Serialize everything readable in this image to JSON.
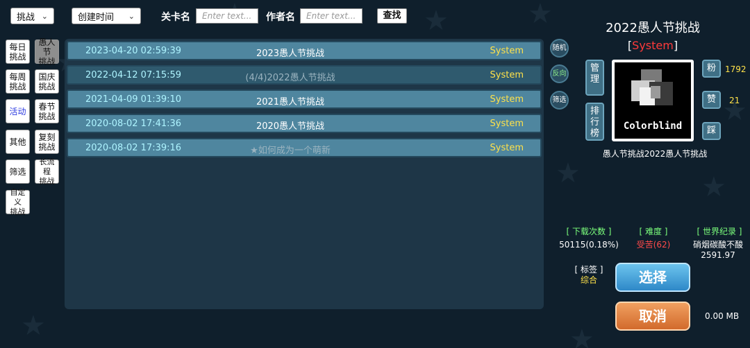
{
  "topbar": {
    "mode_value": "挑战",
    "sort_value": "创建时间",
    "level_name_label": "关卡名",
    "level_name_placeholder": "Enter text...",
    "author_label": "作者名",
    "author_placeholder": "Enter text...",
    "search_label": "查找"
  },
  "categories": [
    {
      "label": "每日\n挑战"
    },
    {
      "label": "愚人节\n挑战"
    },
    {
      "label": "每周\n挑战"
    },
    {
      "label": "国庆\n挑战"
    },
    {
      "label": "活动"
    },
    {
      "label": "春节\n挑战"
    },
    {
      "label": "其他"
    },
    {
      "label": "复刻\n挑战"
    },
    {
      "label": "筛选"
    },
    {
      "label": "长流程\n挑战"
    },
    {
      "label": "自定义\n挑战"
    }
  ],
  "levels": [
    {
      "date": "2023-04-20 02:59:39",
      "title": "2023愚人节挑战",
      "author": "System"
    },
    {
      "date": "2022-04-12 07:15:59",
      "title": "(4/4)2022愚人节挑战",
      "author": "System"
    },
    {
      "date": "2021-04-09 01:39:10",
      "title": "2021愚人节挑战",
      "author": "System"
    },
    {
      "date": "2020-08-02 17:41:36",
      "title": "2020愚人节挑战",
      "author": "System"
    },
    {
      "date": "2020-08-02 17:39:16",
      "title": "★如何成为一个萌新",
      "author": "System"
    }
  ],
  "side_buttons": {
    "random": "随机",
    "reverse": "反向",
    "filter": "筛选"
  },
  "detail": {
    "title": "2022愚人节挑战",
    "author_open": "[",
    "author": "System",
    "author_close": "]",
    "manage_label": "管理",
    "rank_label": "排行榜",
    "fans_label": "粉",
    "fans_count": "1792",
    "like_label": "赞",
    "like_count": "21",
    "dislike_label": "踩",
    "thumbnail_text": "Colorblind",
    "level_name": "愚人节挑战2022愚人节挑战",
    "downloads_label": "[ 下载次数 ]",
    "downloads_value": "50115(0.18%)",
    "difficulty_label": "[ 难度 ]",
    "difficulty_value": "受苦(62)",
    "record_label": "[ 世界纪录 ]",
    "record_holder": "硝烟碳酸不酸",
    "record_value": "2591.97",
    "tag_label": "[ 标签 ]",
    "tag_value": "综合",
    "select_label": "选择",
    "cancel_label": "取消",
    "size": "0.00 MB"
  },
  "colors": {
    "background": "#0f1f2c",
    "row_light": "#4f869f",
    "row_dark": "#2f5a6e",
    "date_text": "#aef4ff",
    "author_yellow": "#ffe24a",
    "accent_red": "#ff3a3a",
    "label_green": "#7cff7c"
  }
}
